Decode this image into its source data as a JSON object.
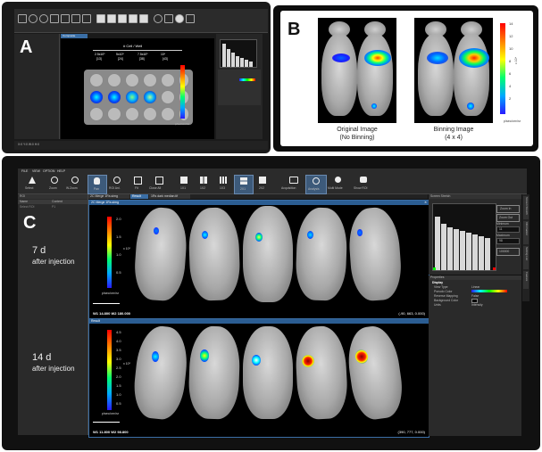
{
  "panel_a": {
    "letter": "A",
    "tabs": [
      "Composite"
    ],
    "header": {
      "title": "# Cell / Well",
      "values": [
        "2.5x10⁵",
        "5x10⁵",
        "7.5x10⁵",
        "10⁶"
      ],
      "units": [
        "[13]",
        "[24]",
        "[38]",
        "[43]"
      ]
    },
    "colorbar_label": "p/sec/cm²/sr",
    "status": "X:0 Y:0 W:0 H:0"
  },
  "panel_b": {
    "letter": "B",
    "left_caption": [
      "Original Image",
      "(No Binning)"
    ],
    "right_caption": [
      "Binning Image",
      "(4 x 4)"
    ],
    "colorbar_ticks": [
      "14",
      "12",
      "10",
      "8",
      "6",
      "4",
      "2"
    ],
    "colorbar_exp": "x 10⁴",
    "colorbar_unit": "p/sec/cm²/sr"
  },
  "panel_c": {
    "letter": "C",
    "menu": [
      "FILE",
      "VIEW",
      "OPTION",
      "HELP"
    ],
    "toolbar": [
      "Select",
      "Zoom",
      "W.Zoom",
      "Pan",
      "ROI Anl.",
      "Fit",
      "Close All",
      "1X1",
      "1X2",
      "1X3",
      "2X1",
      "2X2",
      "Acquisition",
      "Analysis",
      "Multi Mode",
      "Show ROI"
    ],
    "roi_panel": {
      "title": "ROI",
      "cols": [
        "Name",
        "Content"
      ],
      "row": [
        "Select ROI",
        "P1"
      ]
    },
    "tabs": [
      "2C Merge 1Rs.simg",
      "Result",
      "1Rs dark median.tif"
    ],
    "row1": {
      "label": "7 d",
      "sub": "after injection",
      "title": "2C Merge 1Rs.simg",
      "wl": "W1 14.800  W2 180.000",
      "coords": "(-90, 663, 0.000)",
      "ticks": [
        "2.0",
        "1.5",
        "1.0",
        "0.5"
      ],
      "exp": "x 10⁵",
      "unit": "p/sec/cm²/sr"
    },
    "row2": {
      "label": "14 d",
      "sub": "after injection",
      "title": "Result",
      "wl": "W1 11.800  W2 98.800",
      "coords": "(390, 777, 0.000)",
      "ticks": [
        "4.5",
        "4.0",
        "3.5",
        "3.0",
        "2.5",
        "2.0",
        "1.5",
        "1.0",
        "0.5"
      ],
      "exp": "x 10⁵",
      "unit": "p/sec/cm²/sr"
    },
    "screen_stretch": {
      "title": "Screen Stretch",
      "buttons": [
        "Zoom In",
        "Zoom Out",
        "Minimum",
        "Maximum"
      ],
      "values": [
        "11",
        "98",
        "100000"
      ]
    },
    "properties": {
      "title": "Properties",
      "section": "Display",
      "rows": [
        [
          "View Type",
          "Linear"
        ],
        [
          "Pseudo Color",
          ""
        ],
        [
          "Reverse Mapping",
          "False"
        ],
        [
          "Background Color",
          ""
        ],
        [
          "Units",
          "Intensity"
        ]
      ]
    },
    "side_tabs": [
      "Screen Stretch",
      "Information",
      "Setting List",
      "Feature"
    ]
  }
}
